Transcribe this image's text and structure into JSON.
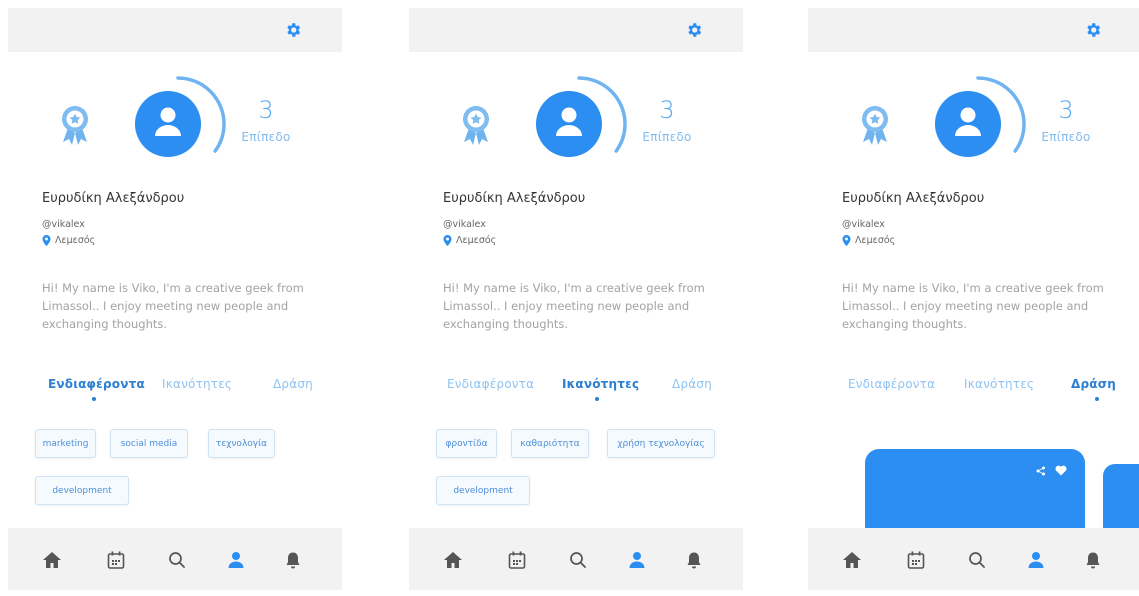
{
  "screens": [
    {
      "profile": {
        "level": "3",
        "level_label": "Επίπεδο",
        "name": "Ευρυδίκη Αλεξάνδρου",
        "handle": "@vikalex",
        "location": "Λεμεσός",
        "bio": "Hi! My name is Viko, I'm a creative geek from Limassol.. I enjoy meeting new people and exchanging thoughts."
      },
      "tabs": [
        "Ενδιαφέροντα",
        "Ικανότητες",
        "Δράση"
      ],
      "active_tab": "Ενδιαφέροντα",
      "chips": [
        "marketing",
        "social media",
        "τεχνολογία",
        "development"
      ]
    },
    {
      "profile": {
        "level": "3",
        "level_label": "Επίπεδο",
        "name": "Ευρυδίκη Αλεξάνδρου",
        "handle": "@vikalex",
        "location": "Λεμεσός",
        "bio": "Hi! My name is Viko, I'm a creative geek from Limassol.. I enjoy meeting new people and exchanging thoughts."
      },
      "tabs": [
        "Ενδιαφέροντα",
        "Ικανότητες",
        "Δράση"
      ],
      "active_tab": "Ικανότητες",
      "chips": [
        "φροντίδα",
        "καθαριότητα",
        "χρήση τεχνολογίας",
        "development"
      ]
    },
    {
      "profile": {
        "level": "3",
        "level_label": "Επίπεδο",
        "name": "Ευρυδίκη Αλεξάνδρου",
        "handle": "@vikalex",
        "location": "Λεμεσός",
        "bio": "Hi! My name is Viko, I'm a creative geek from Limassol.. I enjoy meeting new people and exchanging thoughts."
      },
      "tabs": [
        "Ενδιαφέροντα",
        "Ικανότητες",
        "Δράση"
      ],
      "active_tab": "Δράση",
      "chips": []
    }
  ],
  "level_progress": 0.35,
  "icons": {
    "settings": "gear-icon",
    "badge": "award-ribbon-icon",
    "avatar": "user-avatar-icon",
    "location": "map-pin-icon",
    "nav": [
      "home-icon",
      "calendar-icon",
      "search-icon",
      "profile-icon",
      "bell-icon"
    ],
    "card_actions": [
      "share-icon",
      "heart-icon"
    ]
  },
  "colors": {
    "accent": "#2b8ef0",
    "accent_light": "#7fbcf0",
    "bar_bg": "#f2f2f2",
    "nav_inactive": "#5a5a5a"
  }
}
